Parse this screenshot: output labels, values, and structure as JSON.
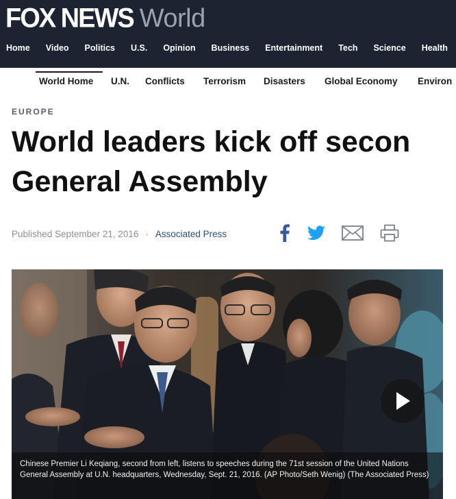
{
  "brand": {
    "logo": "FOX NEWS",
    "section": "World"
  },
  "main_nav": [
    "Home",
    "Video",
    "Politics",
    "U.S.",
    "Opinion",
    "Business",
    "Entertainment",
    "Tech",
    "Science",
    "Health"
  ],
  "sub_nav": {
    "active": "World Home",
    "items": [
      "World Home",
      "U.N.",
      "Conflicts",
      "Terrorism",
      "Disasters",
      "Global Economy",
      "Environ"
    ]
  },
  "article": {
    "kicker": "EUROPE",
    "headline": [
      "World leaders kick off secon",
      "General Assembly"
    ],
    "published": "Published September 21, 2016",
    "separator": "·",
    "source": "Associated Press",
    "share_icons": [
      "facebook-icon",
      "twitter-icon",
      "email-icon",
      "print-icon"
    ],
    "caption": "Chinese Premier Li Keqiang, second from left, listens to speeches during the 71st session of the United Nations General Assembly at U.N. headquarters, Wednesday, Sept. 21, 2016. (AP Photo/Seth Wenig)  (The Associated Press)"
  },
  "colors": {
    "header_bg": "#1b2430",
    "facebook": "#3b5998",
    "twitter": "#1da1f2",
    "link": "#2c4e7e"
  }
}
